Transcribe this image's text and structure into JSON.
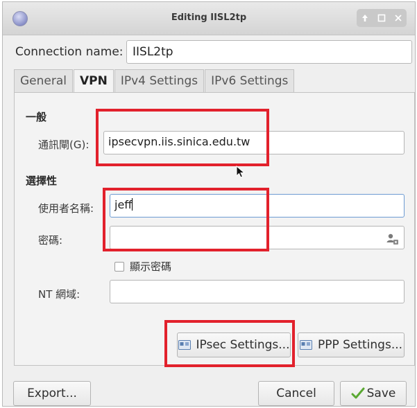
{
  "window": {
    "title": "Editing IISL2tp",
    "controls": [
      "up-arrow-icon",
      "maximize-icon",
      "close-icon"
    ]
  },
  "connection": {
    "label": "Connection name:",
    "value": "IISL2tp"
  },
  "tabs": [
    {
      "label": "General",
      "active": false
    },
    {
      "label": "VPN",
      "active": true
    },
    {
      "label": "IPv4 Settings",
      "active": false
    },
    {
      "label": "IPv6 Settings",
      "active": false
    }
  ],
  "vpn": {
    "general_heading": "一般",
    "gateway_label": "通訊閘(G):",
    "gateway_value": "ipsecvpn.iis.sinica.edu.tw",
    "optional_heading": "選擇性",
    "username_label": "使用者名稱:",
    "username_value": "jeff",
    "password_label": "密碼:",
    "password_value": "",
    "show_password_label": "顯示密碼",
    "show_password_checked": false,
    "nt_domain_label": "NT 網域:",
    "nt_domain_value": "",
    "ipsec_button": "IPsec Settings...",
    "ppp_button": "PPP Settings..."
  },
  "footer": {
    "export": "Export...",
    "cancel": "Cancel",
    "save": "Save"
  },
  "colors": {
    "highlight": "#e2212c",
    "focus_border": "#6c9bd2",
    "save_check": "#5aa832"
  }
}
